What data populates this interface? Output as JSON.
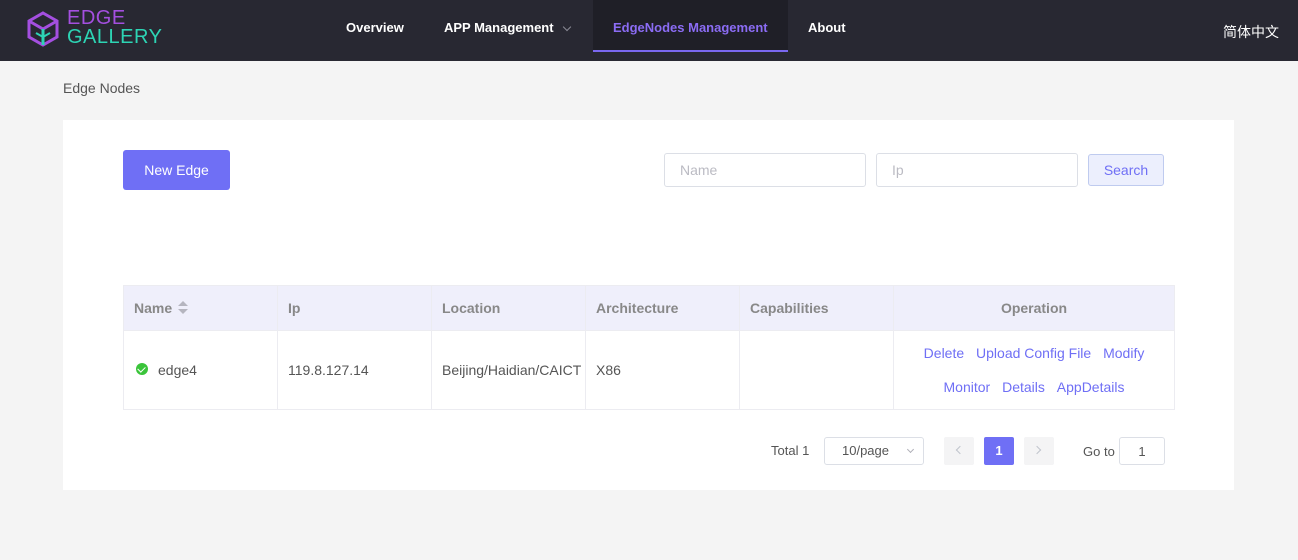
{
  "header": {
    "logo_line1": "EDGE",
    "logo_line2": "GALLERY",
    "nav": [
      {
        "label": "Overview"
      },
      {
        "label": "APP Management"
      },
      {
        "label": "EdgeNodes Management"
      },
      {
        "label": "About"
      }
    ],
    "active_nav": "EdgeNodes Management",
    "language": "简体中文"
  },
  "breadcrumb": "Edge Nodes",
  "toolbar": {
    "new_button": "New Edge",
    "name_placeholder": "Name",
    "ip_placeholder": "Ip",
    "search_button": "Search"
  },
  "table": {
    "columns": [
      "Name",
      "Ip",
      "Location",
      "Architecture",
      "Capabilities",
      "Operation"
    ],
    "rows": [
      {
        "status": "online",
        "name": "edge4",
        "ip": "119.8.127.14",
        "location": "Beijing/Haidian/CAICT",
        "architecture": "X86",
        "capabilities": "",
        "operations": [
          "Delete",
          "Upload Config File",
          "Modify",
          "Monitor",
          "Details",
          "AppDetails"
        ]
      }
    ]
  },
  "pagination": {
    "total_label": "Total 1",
    "page_size": "10/page",
    "current_page": "1",
    "goto_label": "Go to",
    "goto_value": "1"
  },
  "colors": {
    "accent": "#6f6ff5",
    "header_bg": "#282832",
    "status_online": "#3ac43a"
  }
}
